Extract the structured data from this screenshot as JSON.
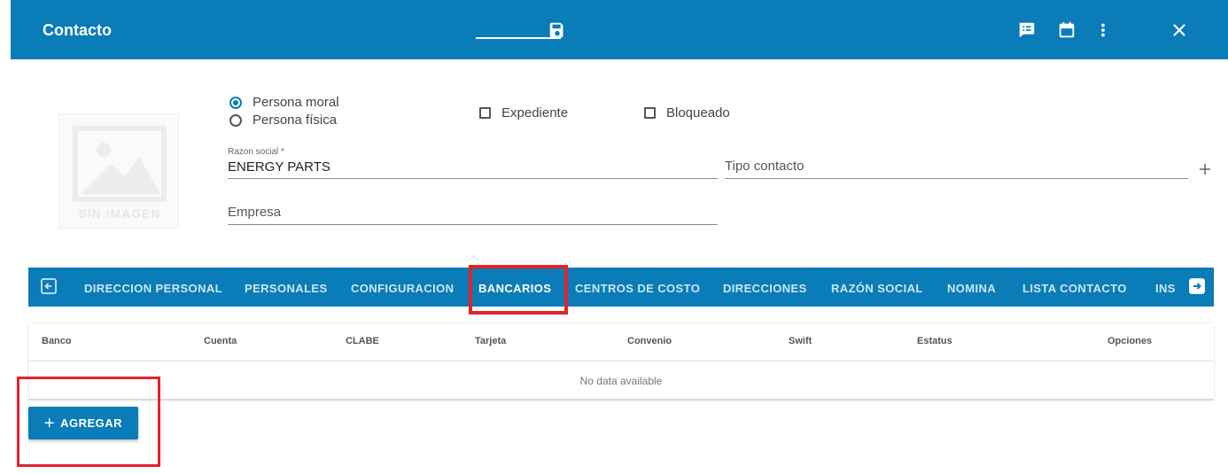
{
  "header": {
    "title": "Contacto",
    "background_color": "#0a7cb8",
    "icons": [
      "save-icon",
      "notes-icon",
      "calendar-icon",
      "more-vert-icon",
      "close-icon"
    ]
  },
  "image_placeholder": {
    "text": "SIN IMAGEN"
  },
  "person_type": {
    "options": [
      {
        "label": "Persona moral",
        "selected": true
      },
      {
        "label": "Persona física",
        "selected": false
      }
    ]
  },
  "checkboxes": {
    "expediente": {
      "label": "Expediente",
      "checked": false
    },
    "bloqueado": {
      "label": "Bloqueado",
      "checked": false
    }
  },
  "fields": {
    "razon_social": {
      "label": "Razon social *",
      "value": "ENERGY PARTS"
    },
    "tipo_contacto": {
      "placeholder": "Tipo contacto"
    },
    "empresa": {
      "placeholder": "Empresa"
    }
  },
  "tabs": [
    {
      "label": "DIRECCION PERSONAL"
    },
    {
      "label": "PERSONALES"
    },
    {
      "label": "CONFIGURACION"
    },
    {
      "label": "BANCARIOS",
      "active": true
    },
    {
      "label": "CENTROS DE COSTO"
    },
    {
      "label": "DIRECCIONES"
    },
    {
      "label": "RAZÓN SOCIAL"
    },
    {
      "label": "NOMINA"
    },
    {
      "label": "LISTA CONTACTO"
    },
    {
      "label": "INS"
    }
  ],
  "table": {
    "headers": [
      "Banco",
      "Cuenta",
      "CLABE",
      "Tarjeta",
      "Convenio",
      "Swift",
      "Estatus",
      "Opciones"
    ],
    "empty_text": "No data available"
  },
  "add_button": {
    "label": "AGREGAR"
  },
  "highlight_color": "#e32229"
}
